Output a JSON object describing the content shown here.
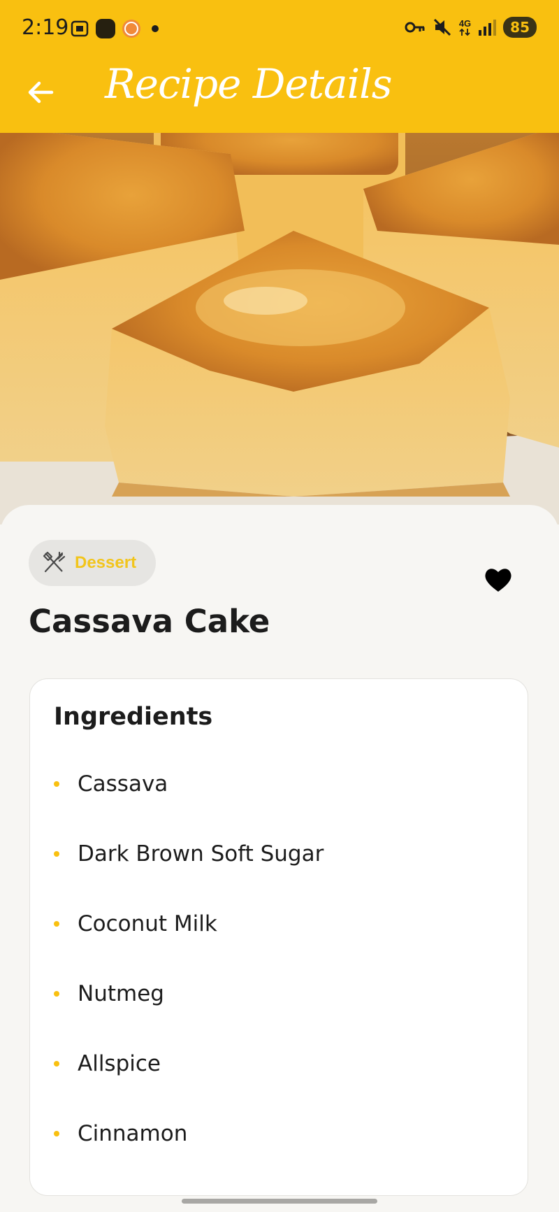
{
  "status_bar": {
    "time": "2:19",
    "network": "4G",
    "battery": "85",
    "icons": [
      "screenshot-icon",
      "app-icon",
      "hp-badge-icon",
      "dot-icon",
      "vpn-key-icon",
      "mute-icon",
      "signal-icon"
    ]
  },
  "app_bar": {
    "title": "Recipe Details",
    "back_icon": "arrow-left-icon",
    "color": "#f9c010"
  },
  "recipe": {
    "category": "Dessert",
    "category_icon": "fork-knife-icon",
    "name": "Cassava Cake",
    "favorite_icon": "heart-icon",
    "ingredients_title": "Ingredients",
    "ingredients": [
      "Cassava",
      "Dark Brown Soft Sugar",
      "Coconut Milk",
      "Nutmeg",
      "Allspice",
      "Cinnamon"
    ]
  }
}
